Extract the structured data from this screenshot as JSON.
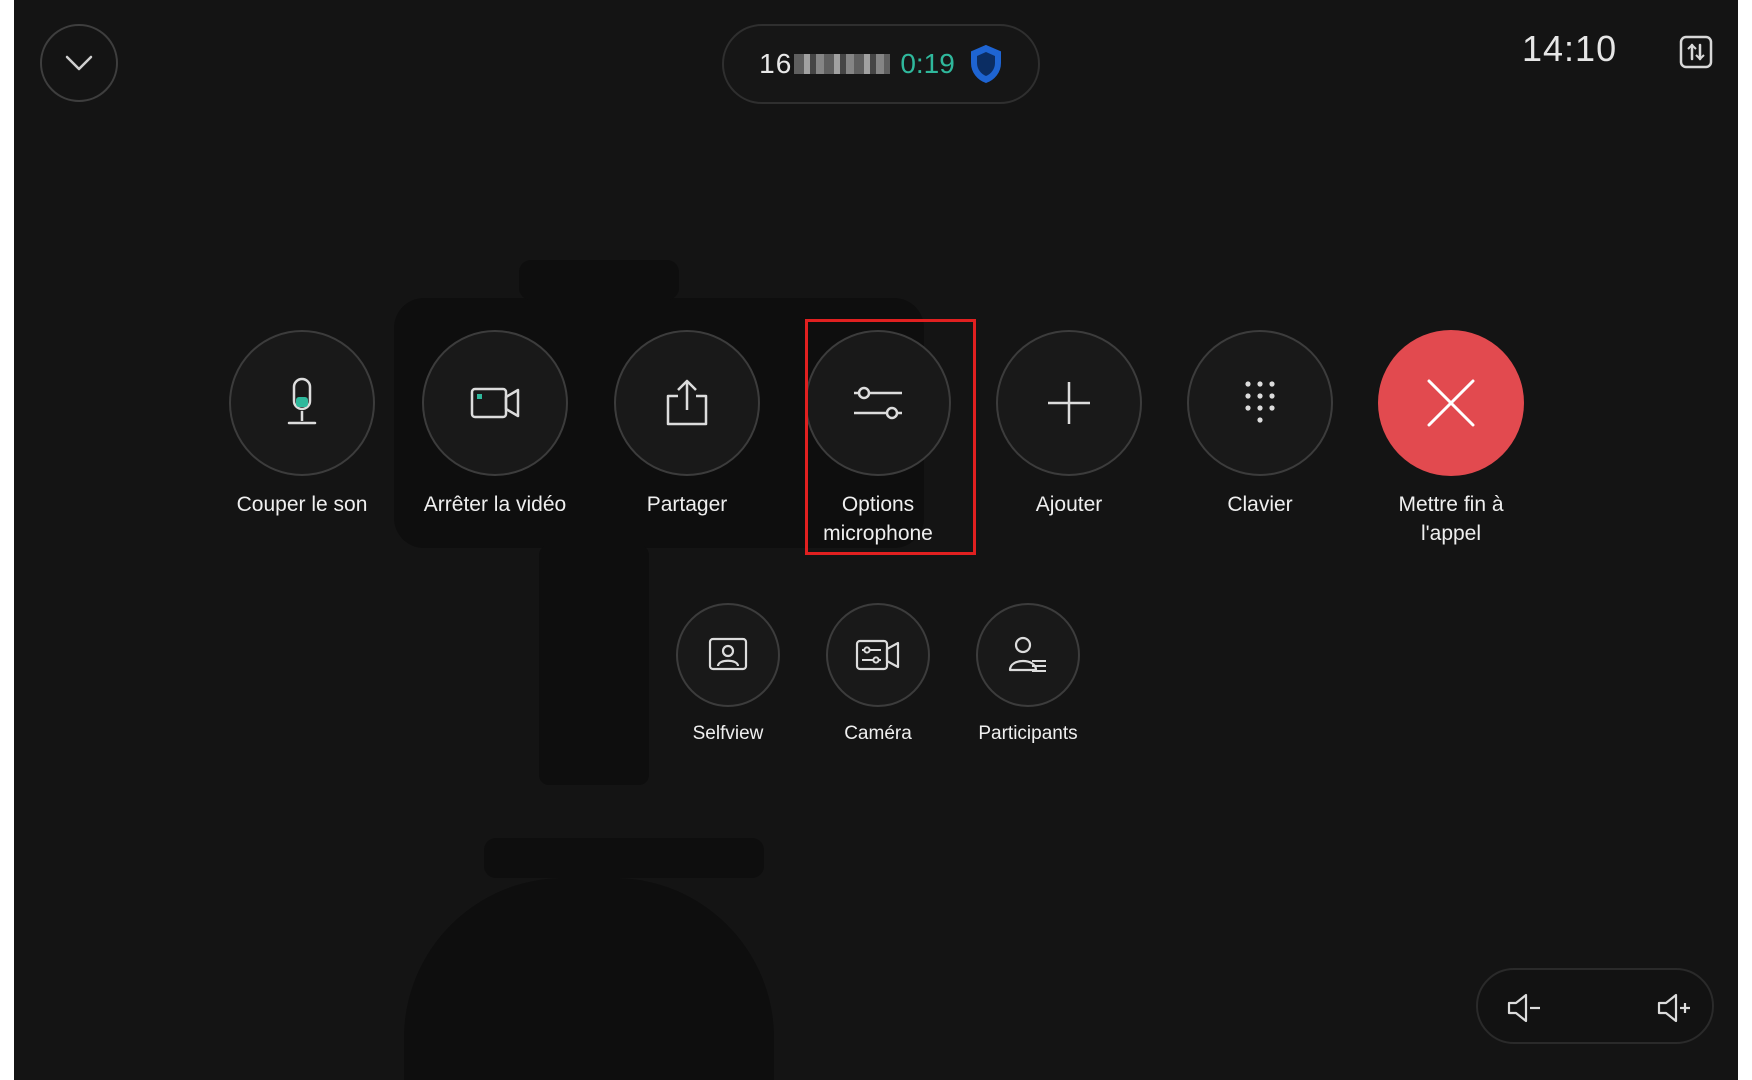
{
  "header": {
    "call_number_visible": "16",
    "call_duration": "0:19",
    "clock": "14:10"
  },
  "controls": {
    "mute": "Couper le son",
    "stop_video": "Arrêter la vidéo",
    "share": "Partager",
    "mic_options_line1": "Options",
    "mic_options_line2": "microphone",
    "add": "Ajouter",
    "keypad": "Clavier",
    "end_call_line1": "Mettre fin à",
    "end_call_line2": "l'appel"
  },
  "secondary": {
    "selfview": "Selfview",
    "camera": "Caméra",
    "participants": "Participants"
  },
  "colors": {
    "accent_teal": "#2fb89c",
    "end_call_red": "#e24a4f",
    "highlight_red": "#e02020",
    "shield_blue": "#1e64d2"
  },
  "icons": [
    "chevron-down-icon",
    "shield-icon",
    "layout-icon",
    "microphone-icon",
    "video-camera-icon",
    "share-icon",
    "sliders-icon",
    "plus-icon",
    "keypad-icon",
    "close-icon",
    "selfview-icon",
    "camera-control-icon",
    "participants-icon",
    "volume-down-icon",
    "volume-up-icon"
  ]
}
